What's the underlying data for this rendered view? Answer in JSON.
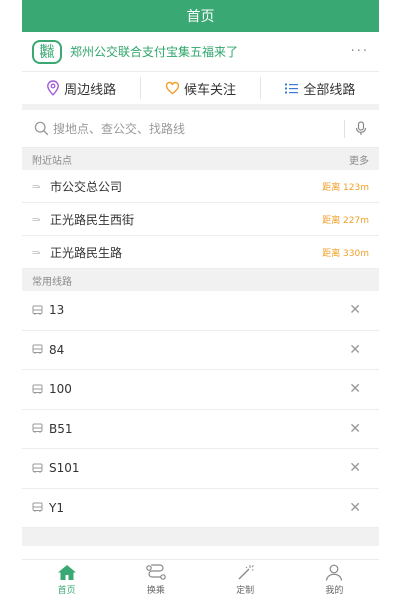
{
  "header": {
    "title": "首页"
  },
  "news": {
    "logo_text_1": "指尖",
    "logo_text_2": "快讯",
    "text": "郑州公交联合支付宝集五福来了",
    "more": "···"
  },
  "quick": [
    {
      "label": "周边线路",
      "icon": "location-pin-icon"
    },
    {
      "label": "候车关注",
      "icon": "heart-icon"
    },
    {
      "label": "全部线路",
      "icon": "list-icon"
    }
  ],
  "search": {
    "placeholder": "搜地点、查公交、找路线"
  },
  "nearby": {
    "title": "附近站点",
    "more": "更多",
    "stops": [
      {
        "name": "市公交总公司",
        "distance": "距离 123m"
      },
      {
        "name": "正光路民生西街",
        "distance": "距离 227m"
      },
      {
        "name": "正光路民生路",
        "distance": "距离 330m"
      }
    ]
  },
  "routes": {
    "title": "常用线路",
    "items": [
      "13",
      "84",
      "100",
      "B51",
      "S101",
      "Y1"
    ]
  },
  "tabs": [
    {
      "label": "首页",
      "icon": "home-icon",
      "active": true
    },
    {
      "label": "换乘",
      "icon": "transfer-icon",
      "active": false
    },
    {
      "label": "定制",
      "icon": "magic-wand-icon",
      "active": false
    },
    {
      "label": "我的",
      "icon": "user-icon",
      "active": false
    }
  ],
  "colors": {
    "brand": "#3aa873",
    "distance": "#f0a02a"
  }
}
